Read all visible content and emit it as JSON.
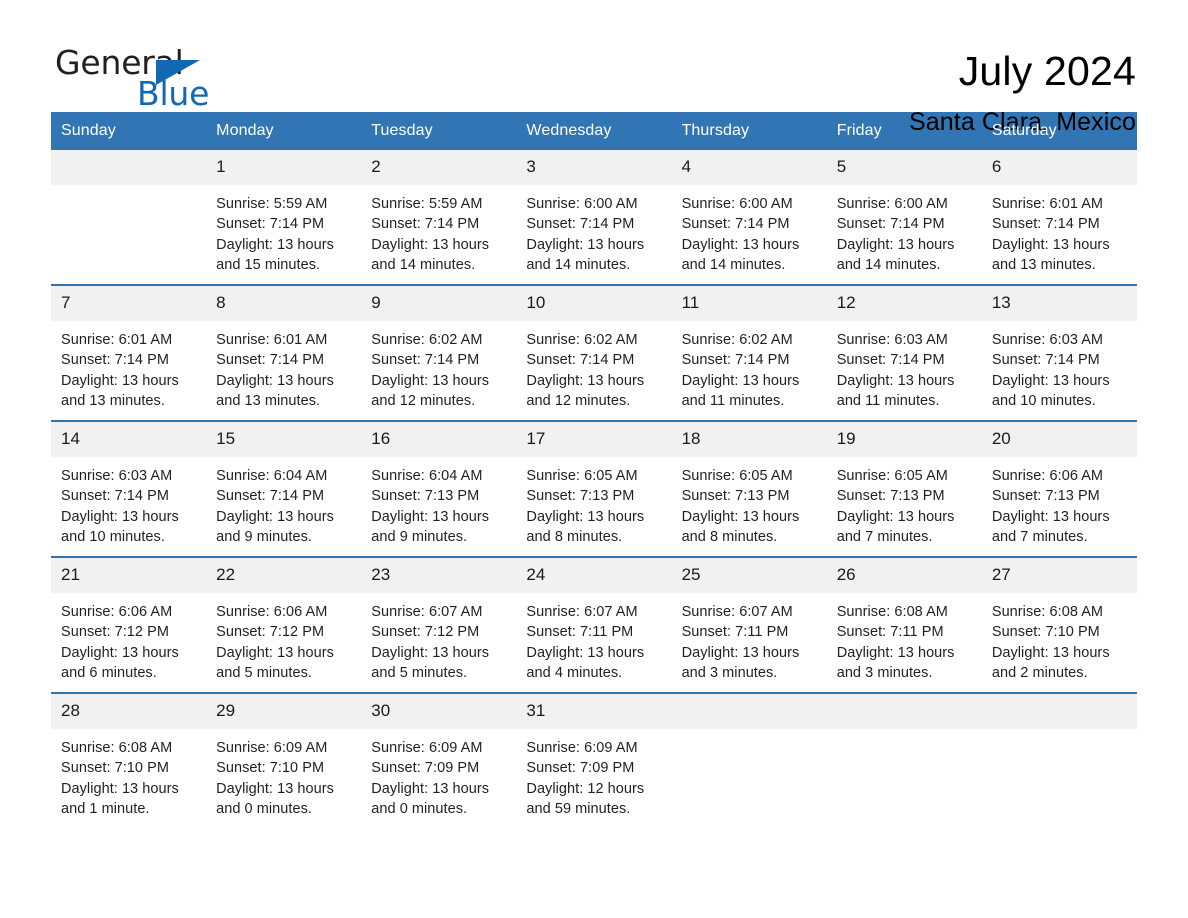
{
  "brand": {
    "word_one": "General",
    "word_two": "Blue",
    "flag_icon": "triangle-flag-icon",
    "accent_color": "#1268b3"
  },
  "header": {
    "month_title": "July 2024",
    "location": "Santa Clara, Mexico"
  },
  "theme": {
    "header_blue": "#3275b5",
    "daynum_background": "#f1f1f1",
    "text_color": "#231f20"
  },
  "calendar": {
    "weekday_headers": [
      "Sunday",
      "Monday",
      "Tuesday",
      "Wednesday",
      "Thursday",
      "Friday",
      "Saturday"
    ],
    "weeks": [
      [
        {
          "day": "",
          "info": "",
          "empty": true
        },
        {
          "day": "1",
          "info": "Sunrise: 5:59 AM\nSunset: 7:14 PM\nDaylight: 13 hours and 15 minutes."
        },
        {
          "day": "2",
          "info": "Sunrise: 5:59 AM\nSunset: 7:14 PM\nDaylight: 13 hours and 14 minutes."
        },
        {
          "day": "3",
          "info": "Sunrise: 6:00 AM\nSunset: 7:14 PM\nDaylight: 13 hours and 14 minutes."
        },
        {
          "day": "4",
          "info": "Sunrise: 6:00 AM\nSunset: 7:14 PM\nDaylight: 13 hours and 14 minutes."
        },
        {
          "day": "5",
          "info": "Sunrise: 6:00 AM\nSunset: 7:14 PM\nDaylight: 13 hours and 14 minutes."
        },
        {
          "day": "6",
          "info": "Sunrise: 6:01 AM\nSunset: 7:14 PM\nDaylight: 13 hours and 13 minutes."
        }
      ],
      [
        {
          "day": "7",
          "info": "Sunrise: 6:01 AM\nSunset: 7:14 PM\nDaylight: 13 hours and 13 minutes."
        },
        {
          "day": "8",
          "info": "Sunrise: 6:01 AM\nSunset: 7:14 PM\nDaylight: 13 hours and 13 minutes."
        },
        {
          "day": "9",
          "info": "Sunrise: 6:02 AM\nSunset: 7:14 PM\nDaylight: 13 hours and 12 minutes."
        },
        {
          "day": "10",
          "info": "Sunrise: 6:02 AM\nSunset: 7:14 PM\nDaylight: 13 hours and 12 minutes."
        },
        {
          "day": "11",
          "info": "Sunrise: 6:02 AM\nSunset: 7:14 PM\nDaylight: 13 hours and 11 minutes."
        },
        {
          "day": "12",
          "info": "Sunrise: 6:03 AM\nSunset: 7:14 PM\nDaylight: 13 hours and 11 minutes."
        },
        {
          "day": "13",
          "info": "Sunrise: 6:03 AM\nSunset: 7:14 PM\nDaylight: 13 hours and 10 minutes."
        }
      ],
      [
        {
          "day": "14",
          "info": "Sunrise: 6:03 AM\nSunset: 7:14 PM\nDaylight: 13 hours and 10 minutes."
        },
        {
          "day": "15",
          "info": "Sunrise: 6:04 AM\nSunset: 7:14 PM\nDaylight: 13 hours and 9 minutes."
        },
        {
          "day": "16",
          "info": "Sunrise: 6:04 AM\nSunset: 7:13 PM\nDaylight: 13 hours and 9 minutes."
        },
        {
          "day": "17",
          "info": "Sunrise: 6:05 AM\nSunset: 7:13 PM\nDaylight: 13 hours and 8 minutes."
        },
        {
          "day": "18",
          "info": "Sunrise: 6:05 AM\nSunset: 7:13 PM\nDaylight: 13 hours and 8 minutes."
        },
        {
          "day": "19",
          "info": "Sunrise: 6:05 AM\nSunset: 7:13 PM\nDaylight: 13 hours and 7 minutes."
        },
        {
          "day": "20",
          "info": "Sunrise: 6:06 AM\nSunset: 7:13 PM\nDaylight: 13 hours and 7 minutes."
        }
      ],
      [
        {
          "day": "21",
          "info": "Sunrise: 6:06 AM\nSunset: 7:12 PM\nDaylight: 13 hours and 6 minutes."
        },
        {
          "day": "22",
          "info": "Sunrise: 6:06 AM\nSunset: 7:12 PM\nDaylight: 13 hours and 5 minutes."
        },
        {
          "day": "23",
          "info": "Sunrise: 6:07 AM\nSunset: 7:12 PM\nDaylight: 13 hours and 5 minutes."
        },
        {
          "day": "24",
          "info": "Sunrise: 6:07 AM\nSunset: 7:11 PM\nDaylight: 13 hours and 4 minutes."
        },
        {
          "day": "25",
          "info": "Sunrise: 6:07 AM\nSunset: 7:11 PM\nDaylight: 13 hours and 3 minutes."
        },
        {
          "day": "26",
          "info": "Sunrise: 6:08 AM\nSunset: 7:11 PM\nDaylight: 13 hours and 3 minutes."
        },
        {
          "day": "27",
          "info": "Sunrise: 6:08 AM\nSunset: 7:10 PM\nDaylight: 13 hours and 2 minutes."
        }
      ],
      [
        {
          "day": "28",
          "info": "Sunrise: 6:08 AM\nSunset: 7:10 PM\nDaylight: 13 hours and 1 minute."
        },
        {
          "day": "29",
          "info": "Sunrise: 6:09 AM\nSunset: 7:10 PM\nDaylight: 13 hours and 0 minutes."
        },
        {
          "day": "30",
          "info": "Sunrise: 6:09 AM\nSunset: 7:09 PM\nDaylight: 13 hours and 0 minutes."
        },
        {
          "day": "31",
          "info": "Sunrise: 6:09 AM\nSunset: 7:09 PM\nDaylight: 12 hours and 59 minutes."
        },
        {
          "day": "",
          "info": "",
          "empty": true
        },
        {
          "day": "",
          "info": "",
          "empty": true
        },
        {
          "day": "",
          "info": "",
          "empty": true
        }
      ]
    ]
  }
}
